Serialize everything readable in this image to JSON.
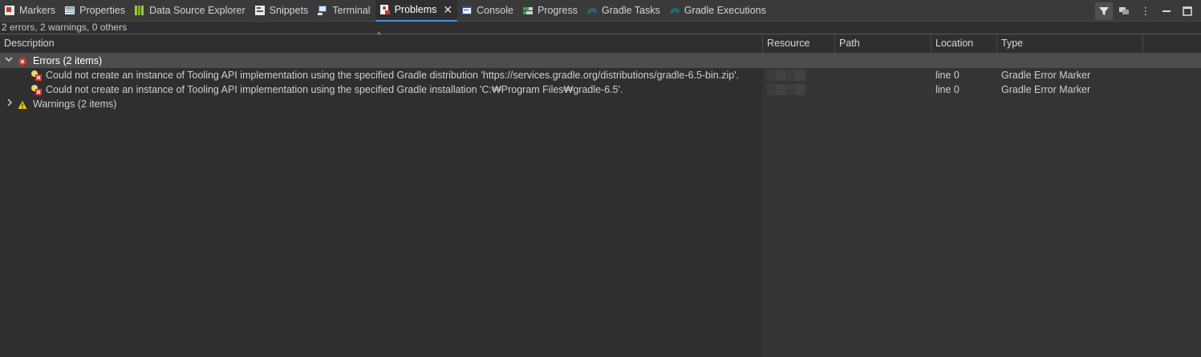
{
  "tabs": [
    {
      "label": "Markers",
      "icon": "markers-icon"
    },
    {
      "label": "Properties",
      "icon": "properties-icon"
    },
    {
      "label": "Data Source Explorer",
      "icon": "data-source-explorer-icon"
    },
    {
      "label": "Snippets",
      "icon": "snippets-icon"
    },
    {
      "label": "Terminal",
      "icon": "terminal-icon"
    },
    {
      "label": "Problems",
      "icon": "problems-icon",
      "active": true
    },
    {
      "label": "Console",
      "icon": "console-icon"
    },
    {
      "label": "Progress",
      "icon": "progress-icon"
    },
    {
      "label": "Gradle Tasks",
      "icon": "gradle-elephant-icon"
    },
    {
      "label": "Gradle Executions",
      "icon": "gradle-elephant-icon"
    }
  ],
  "toolbar": {
    "filter": "filter-icon",
    "view_menu": "view-menu-icon",
    "minimize": "minimize-icon",
    "maximize": "maximize-icon"
  },
  "summary": "2 errors, 2 warnings, 0 others",
  "columns": {
    "description": "Description",
    "resource": "Resource",
    "path": "Path",
    "location": "Location",
    "type": "Type"
  },
  "groups": {
    "errors": {
      "label": "Errors (2 items)",
      "items": [
        {
          "description": "Could not create an instance of Tooling API implementation using the specified Gradle distribution 'https://services.gradle.org/distributions/gradle-6.5-bin.zip'.",
          "location": "line 0",
          "type": "Gradle Error Marker"
        },
        {
          "description": "Could not create an instance of Tooling API implementation using the specified Gradle installation 'C:₩Program Files₩gradle-6.5'.",
          "location": "line 0",
          "type": "Gradle Error Marker"
        }
      ]
    },
    "warnings": {
      "label": "Warnings (2 items)"
    }
  },
  "colors": {
    "background": "#2f2f2f",
    "tabbar": "#3a3a3a",
    "active_underline": "#4a90e2",
    "error_red": "#d9302c",
    "warning_yellow": "#f2c200",
    "selection": "#4d4d4d"
  }
}
